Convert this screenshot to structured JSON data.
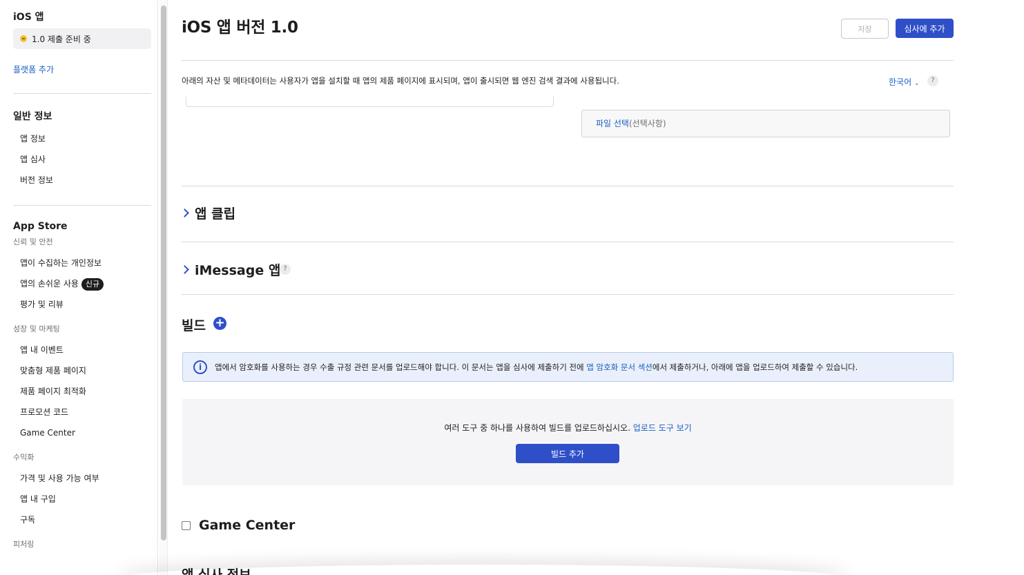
{
  "sidebar": {
    "app_header": "iOS 앱",
    "status": "1.0 제출 준비 중",
    "add_platform": "플랫폼 추가",
    "general": {
      "title": "일반 정보",
      "items": [
        "앱 정보",
        "앱 심사",
        "버전 정보"
      ]
    },
    "appstore": {
      "title": "App Store",
      "trust_label": "신뢰 및 안전",
      "trust_items": [
        "앱이 수집하는 개인정보",
        "앱의 손쉬운 사용",
        "평가 및 리뷰"
      ],
      "new_badge": "신규",
      "growth_label": "성장 및 마케팅",
      "growth_items": [
        "앱 내 이벤트",
        "맞춤형 제품 페이지",
        "제품 페이지 최적화",
        "프로모션 코드",
        "Game Center"
      ],
      "monetize_label": "수익화",
      "monetize_items": [
        "가격 및 사용 가능 여부",
        "앱 내 구입",
        "구독"
      ],
      "featuring_label": "피처링"
    }
  },
  "header": {
    "title": "iOS 앱 버전 1.0",
    "save_label": "저장",
    "submit_label": "심사에 추가"
  },
  "main": {
    "description": "아래의 자산 및 메타데이터는 사용자가 앱을 설치할 때 앱의 제품 페이지에 표시되며, 앱이 출시되면 웹 엔진 검색 결과에 사용됩니다.",
    "language": "한국어",
    "file_select": "파일 선택",
    "file_optional": "(선택사항)",
    "app_clip": "앱 클립",
    "imessage": "iMessage 앱",
    "build_title": "빌드",
    "info_text_1": "앱에서 암호화를 사용하는 경우 수출 규정 관련 문서를 업로드해야 합니다. 이 문서는 앱을 심사에 제출하기 전에 ",
    "info_link": "앱 암호화 문서 섹션",
    "info_text_2": "에서 제출하거나, 아래에 앱을 업로드하여 제출할 수 있습니다.",
    "upload_text": "여러 도구 중 하나를 사용하여 빌드를 업로드하십시오. ",
    "upload_link": "업로드 도구 보기",
    "add_build": "빌드 추가",
    "game_center": "Game Center",
    "review_title": "앱 심사 정보"
  }
}
